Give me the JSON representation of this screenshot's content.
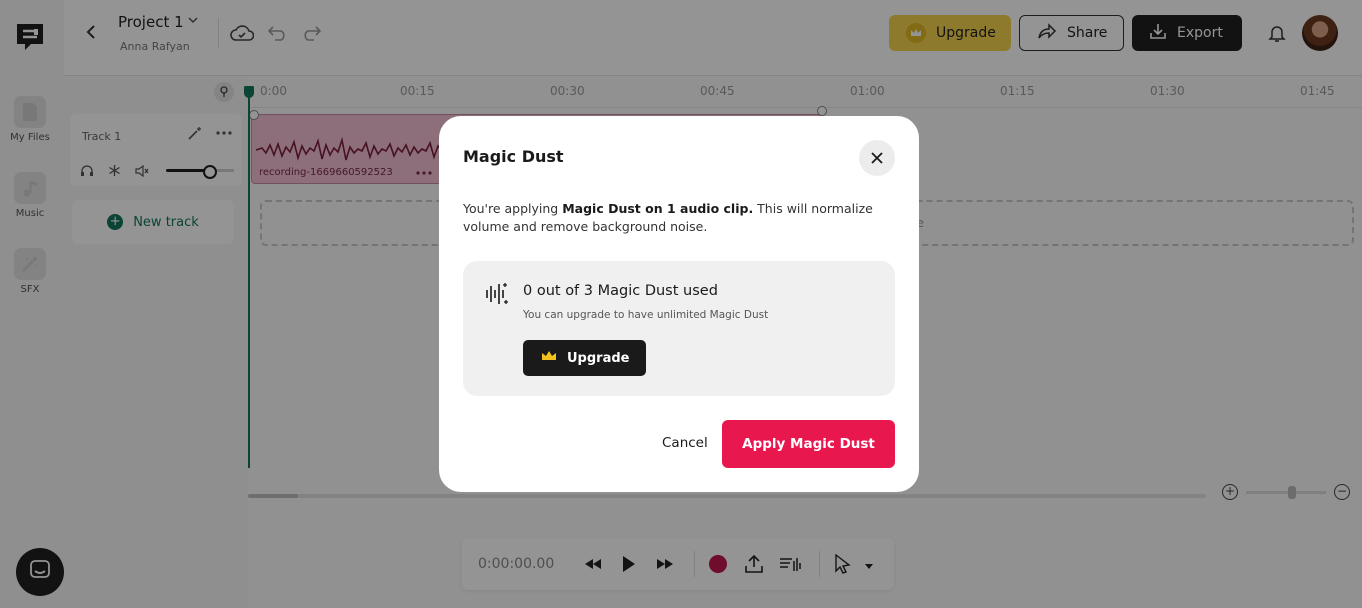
{
  "app": {
    "nav": [
      {
        "label": "My Files",
        "icon": "file-icon"
      },
      {
        "label": "Music",
        "icon": "music-icon"
      },
      {
        "label": "SFX",
        "icon": "magic-wand-icon"
      }
    ]
  },
  "header": {
    "project_title": "Project 1",
    "owner": "Anna Rafyan",
    "upgrade_label": "Upgrade",
    "share_label": "Share",
    "export_label": "Export",
    "accent_color": "#f4d34d"
  },
  "tracks": {
    "track_name": "Track 1",
    "new_track_label": "New track",
    "volume": 0.78
  },
  "timeline": {
    "ticks": [
      "0:00",
      "00:15",
      "00:30",
      "00:45",
      "01:00",
      "01:15",
      "01:30",
      "01:45"
    ],
    "clip_label": "recording-1669660592523",
    "clip_color": "#f2bfd2",
    "drop_text": "e"
  },
  "transport": {
    "time": "0:00:00.00",
    "record_color": "#c0184c"
  },
  "modal": {
    "title": "Magic Dust",
    "desc_prefix": "You're applying ",
    "desc_bold": "Magic Dust on 1 audio clip.",
    "desc_suffix": " This will normalize volume and remove background noise.",
    "usage_title": "0 out of 3 Magic Dust used",
    "usage_subtitle": "You can upgrade to have unlimited Magic Dust",
    "upgrade_label": "Upgrade",
    "cancel_label": "Cancel",
    "apply_label": "Apply Magic Dust",
    "apply_color": "#e8184f"
  }
}
